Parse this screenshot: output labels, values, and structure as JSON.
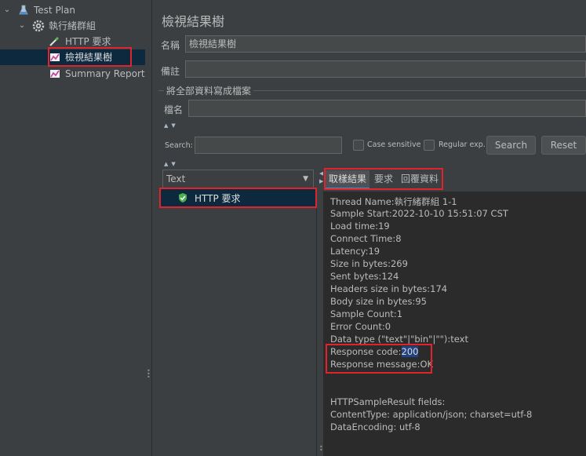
{
  "tree": {
    "items": [
      {
        "label": "Test Plan",
        "icon": "flask-icon",
        "expanded": true
      },
      {
        "label": "執行緒群組",
        "icon": "gear-icon",
        "expanded": true
      },
      {
        "label": "HTTP 要求",
        "icon": "pipette-icon"
      },
      {
        "label": "檢視結果樹",
        "icon": "chart-icon",
        "selected": true
      },
      {
        "label": "Summary Report",
        "icon": "chart-icon"
      }
    ]
  },
  "panel": {
    "title": "檢視結果樹",
    "name_label": "名稱",
    "name_value": "檢視結果樹",
    "comment_label": "備註",
    "comment_value": "",
    "write_section": "將全部資料寫成檔案",
    "filename_label": "檔名",
    "filename_value": ""
  },
  "search": {
    "label": "Search:",
    "value": "",
    "case_sensitive": "Case sensitive",
    "regex": "Regular exp.",
    "search_button": "Search",
    "reset_button": "Reset"
  },
  "renderer": {
    "selected": "Text"
  },
  "sample_tree": {
    "items": [
      {
        "label": "HTTP 要求",
        "status": "success"
      }
    ]
  },
  "tabs": [
    "取樣結果",
    "要求",
    "回覆資料"
  ],
  "result": {
    "lines": [
      "Thread Name:執行緒群組 1-1",
      "Sample Start:2022-10-10 15:51:07 CST",
      "Load time:19",
      "Connect Time:8",
      "Latency:19",
      "Size in bytes:269",
      "Sent bytes:124",
      "Headers size in bytes:174",
      "Body size in bytes:95",
      "Sample Count:1",
      "Error Count:0",
      "Data type (\"text\"|\"bin\"|\"\"):text"
    ],
    "response_code_label": "Response code:",
    "response_code_value": "200",
    "response_message": "Response message:OK",
    "fields_header": "HTTPSampleResult fields:",
    "content_type": "ContentType: application/json; charset=utf-8",
    "data_encoding": "DataEncoding: utf-8"
  },
  "colors": {
    "highlight": "#e0232d",
    "selection": "#0d293e",
    "code_highlight": "#214283",
    "success": "#4caf50"
  }
}
